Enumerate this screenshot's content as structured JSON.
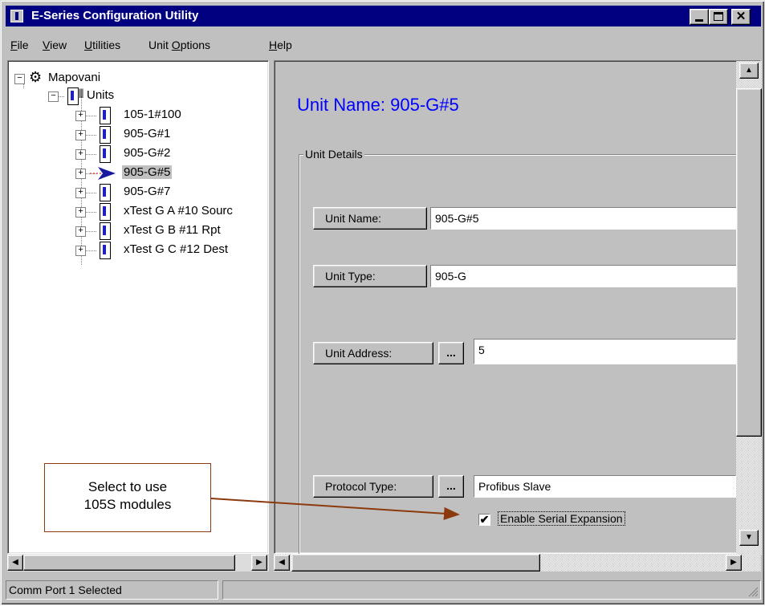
{
  "window": {
    "title": "E-Series Configuration Utility"
  },
  "menu": [
    {
      "pre": "",
      "u": "F",
      "post": "ile"
    },
    {
      "pre": "",
      "u": "V",
      "post": "iew"
    },
    {
      "pre": "",
      "u": "U",
      "post": "tilities"
    },
    {
      "pre": "Unit ",
      "u": "O",
      "post": "ptions"
    },
    {
      "pre": "",
      "u": "H",
      "post": "elp"
    }
  ],
  "tree": {
    "root": "Mapovani",
    "group": "Units",
    "items": [
      "105-1#100",
      "905-G#1",
      "905-G#2",
      "905-G#5",
      "905-G#7",
      "xTest G A #10 Sourc",
      "xTest G B #11 Rpt",
      "xTest G C #12 Dest"
    ],
    "selected_index": 3
  },
  "details": {
    "heading": "Unit Name: 905-G#5",
    "group_label": "Unit Details",
    "unit_name_label": "Unit Name:",
    "unit_name_value": "905-G#5",
    "unit_type_label": "Unit Type:",
    "unit_type_value": "905-G",
    "unit_address_label": "Unit Address:",
    "unit_address_value": "5",
    "protocol_label": "Protocol Type:",
    "protocol_value": "Profibus Slave",
    "dots_label": "...",
    "serial_expansion_label": "Enable Serial Expansion",
    "serial_expansion_checked": true
  },
  "status": {
    "text": "Comm Port 1 Selected"
  },
  "callout": {
    "line1": "Select to use",
    "line2": "105S modules"
  },
  "colors": {
    "titlebar": "#000080",
    "heading": "#0000ff",
    "callout_arrow": "#8b3a0e"
  }
}
